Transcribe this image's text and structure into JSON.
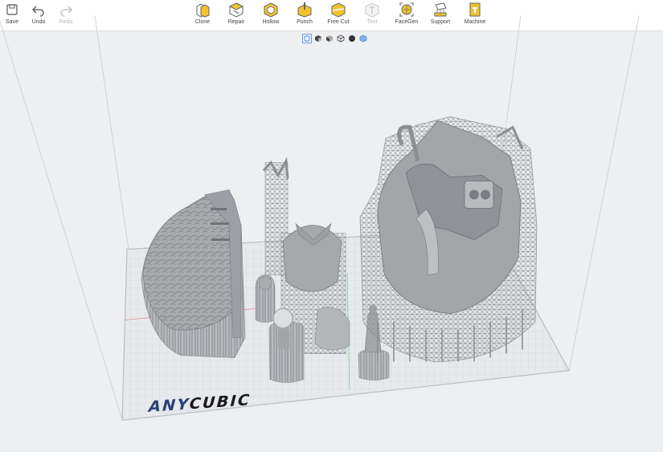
{
  "toolbar": {
    "save": "Save",
    "undo": "Undo",
    "redo": "Redo",
    "clone": "Clone",
    "repair": "Repair",
    "hollow": "Hollow",
    "punch": "Punch",
    "freecut": "Free Cut",
    "text": "Text",
    "facegen": "FaceGen",
    "support": "Support",
    "machine": "Machine"
  },
  "view_icons": [
    "view-iso-icon",
    "view-front-icon",
    "view-side-icon",
    "view-top-icon",
    "view-sphere-icon",
    "view-perspective-icon"
  ],
  "brand": {
    "part1": "ANY",
    "part2": "CUBIC"
  },
  "colors": {
    "accent": "#f2c230",
    "brand_blue": "#2a3f7a",
    "grid": "#cfd2d6"
  }
}
